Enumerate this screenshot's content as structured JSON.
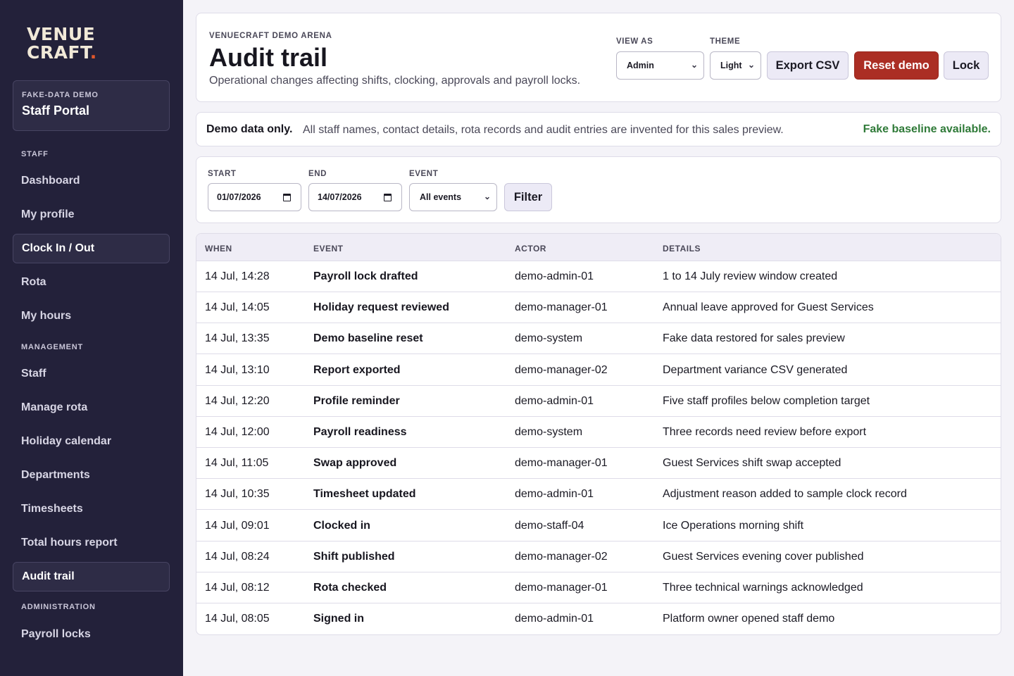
{
  "brand": {
    "logo_line1": "VENUE",
    "logo_line2": "CRAFT",
    "logo_dot": "."
  },
  "portal": {
    "eyebrow": "FAKE-DATA DEMO",
    "title": "Staff Portal"
  },
  "sidebar": {
    "sections": [
      "STAFF",
      "MANAGEMENT",
      "ADMINISTRATION"
    ],
    "items": [
      {
        "label": "Dashboard"
      },
      {
        "label": "My profile"
      },
      {
        "label": "Clock In / Out"
      },
      {
        "label": "Rota"
      },
      {
        "label": "My hours"
      },
      {
        "label": "Staff"
      },
      {
        "label": "Manage rota"
      },
      {
        "label": "Holiday calendar"
      },
      {
        "label": "Departments"
      },
      {
        "label": "Timesheets"
      },
      {
        "label": "Total hours report"
      },
      {
        "label": "Audit trail"
      },
      {
        "label": "Payroll locks"
      }
    ],
    "active": "Audit trail"
  },
  "header": {
    "eyebrow": "VENUECRAFT DEMO ARENA",
    "title": "Audit trail",
    "subtitle": "Operational changes affecting shifts, clocking, approvals and payroll locks.",
    "view_as_label": "VIEW AS",
    "view_as_value": "Admin",
    "theme_label": "THEME",
    "theme_value": "Light",
    "export_label": "Export CSV",
    "reset_label": "Reset demo",
    "lock_label": "Lock"
  },
  "notice": {
    "strong": "Demo data only.",
    "text": "All staff names, contact details, rota records and audit entries are invented for this sales preview.",
    "status": "Fake baseline available."
  },
  "filters": {
    "start_label": "START",
    "start_value": "01/07/2026",
    "end_label": "END",
    "end_value": "14/07/2026",
    "event_label": "EVENT",
    "event_value": "All events",
    "filter_label": "Filter"
  },
  "table": {
    "columns": [
      "WHEN",
      "EVENT",
      "ACTOR",
      "DETAILS"
    ],
    "rows": [
      {
        "when": "14 Jul, 14:28",
        "event": "Payroll lock drafted",
        "actor": "demo-admin-01",
        "details": "1 to 14 July review window created"
      },
      {
        "when": "14 Jul, 14:05",
        "event": "Holiday request reviewed",
        "actor": "demo-manager-01",
        "details": "Annual leave approved for Guest Services"
      },
      {
        "when": "14 Jul, 13:35",
        "event": "Demo baseline reset",
        "actor": "demo-system",
        "details": "Fake data restored for sales preview"
      },
      {
        "when": "14 Jul, 13:10",
        "event": "Report exported",
        "actor": "demo-manager-02",
        "details": "Department variance CSV generated"
      },
      {
        "when": "14 Jul, 12:20",
        "event": "Profile reminder",
        "actor": "demo-admin-01",
        "details": "Five staff profiles below completion target"
      },
      {
        "when": "14 Jul, 12:00",
        "event": "Payroll readiness",
        "actor": "demo-system",
        "details": "Three records need review before export"
      },
      {
        "when": "14 Jul, 11:05",
        "event": "Swap approved",
        "actor": "demo-manager-01",
        "details": "Guest Services shift swap accepted"
      },
      {
        "when": "14 Jul, 10:35",
        "event": "Timesheet updated",
        "actor": "demo-admin-01",
        "details": "Adjustment reason added to sample clock record"
      },
      {
        "when": "14 Jul, 09:01",
        "event": "Clocked in",
        "actor": "demo-staff-04",
        "details": "Ice Operations morning shift"
      },
      {
        "when": "14 Jul, 08:24",
        "event": "Shift published",
        "actor": "demo-manager-02",
        "details": "Guest Services evening cover published"
      },
      {
        "when": "14 Jul, 08:12",
        "event": "Rota checked",
        "actor": "demo-manager-01",
        "details": "Three technical warnings acknowledged"
      },
      {
        "when": "14 Jul, 08:05",
        "event": "Signed in",
        "actor": "demo-admin-01",
        "details": "Platform owner opened staff demo"
      }
    ]
  },
  "icons": {
    "select_chevron": "chevron-down-icon",
    "date_picker": "calendar-icon"
  },
  "colors": {
    "sidebar_bg": "#23213a",
    "danger": "#ab2e24",
    "success": "#2f7a38",
    "accent": "#e0572b"
  }
}
